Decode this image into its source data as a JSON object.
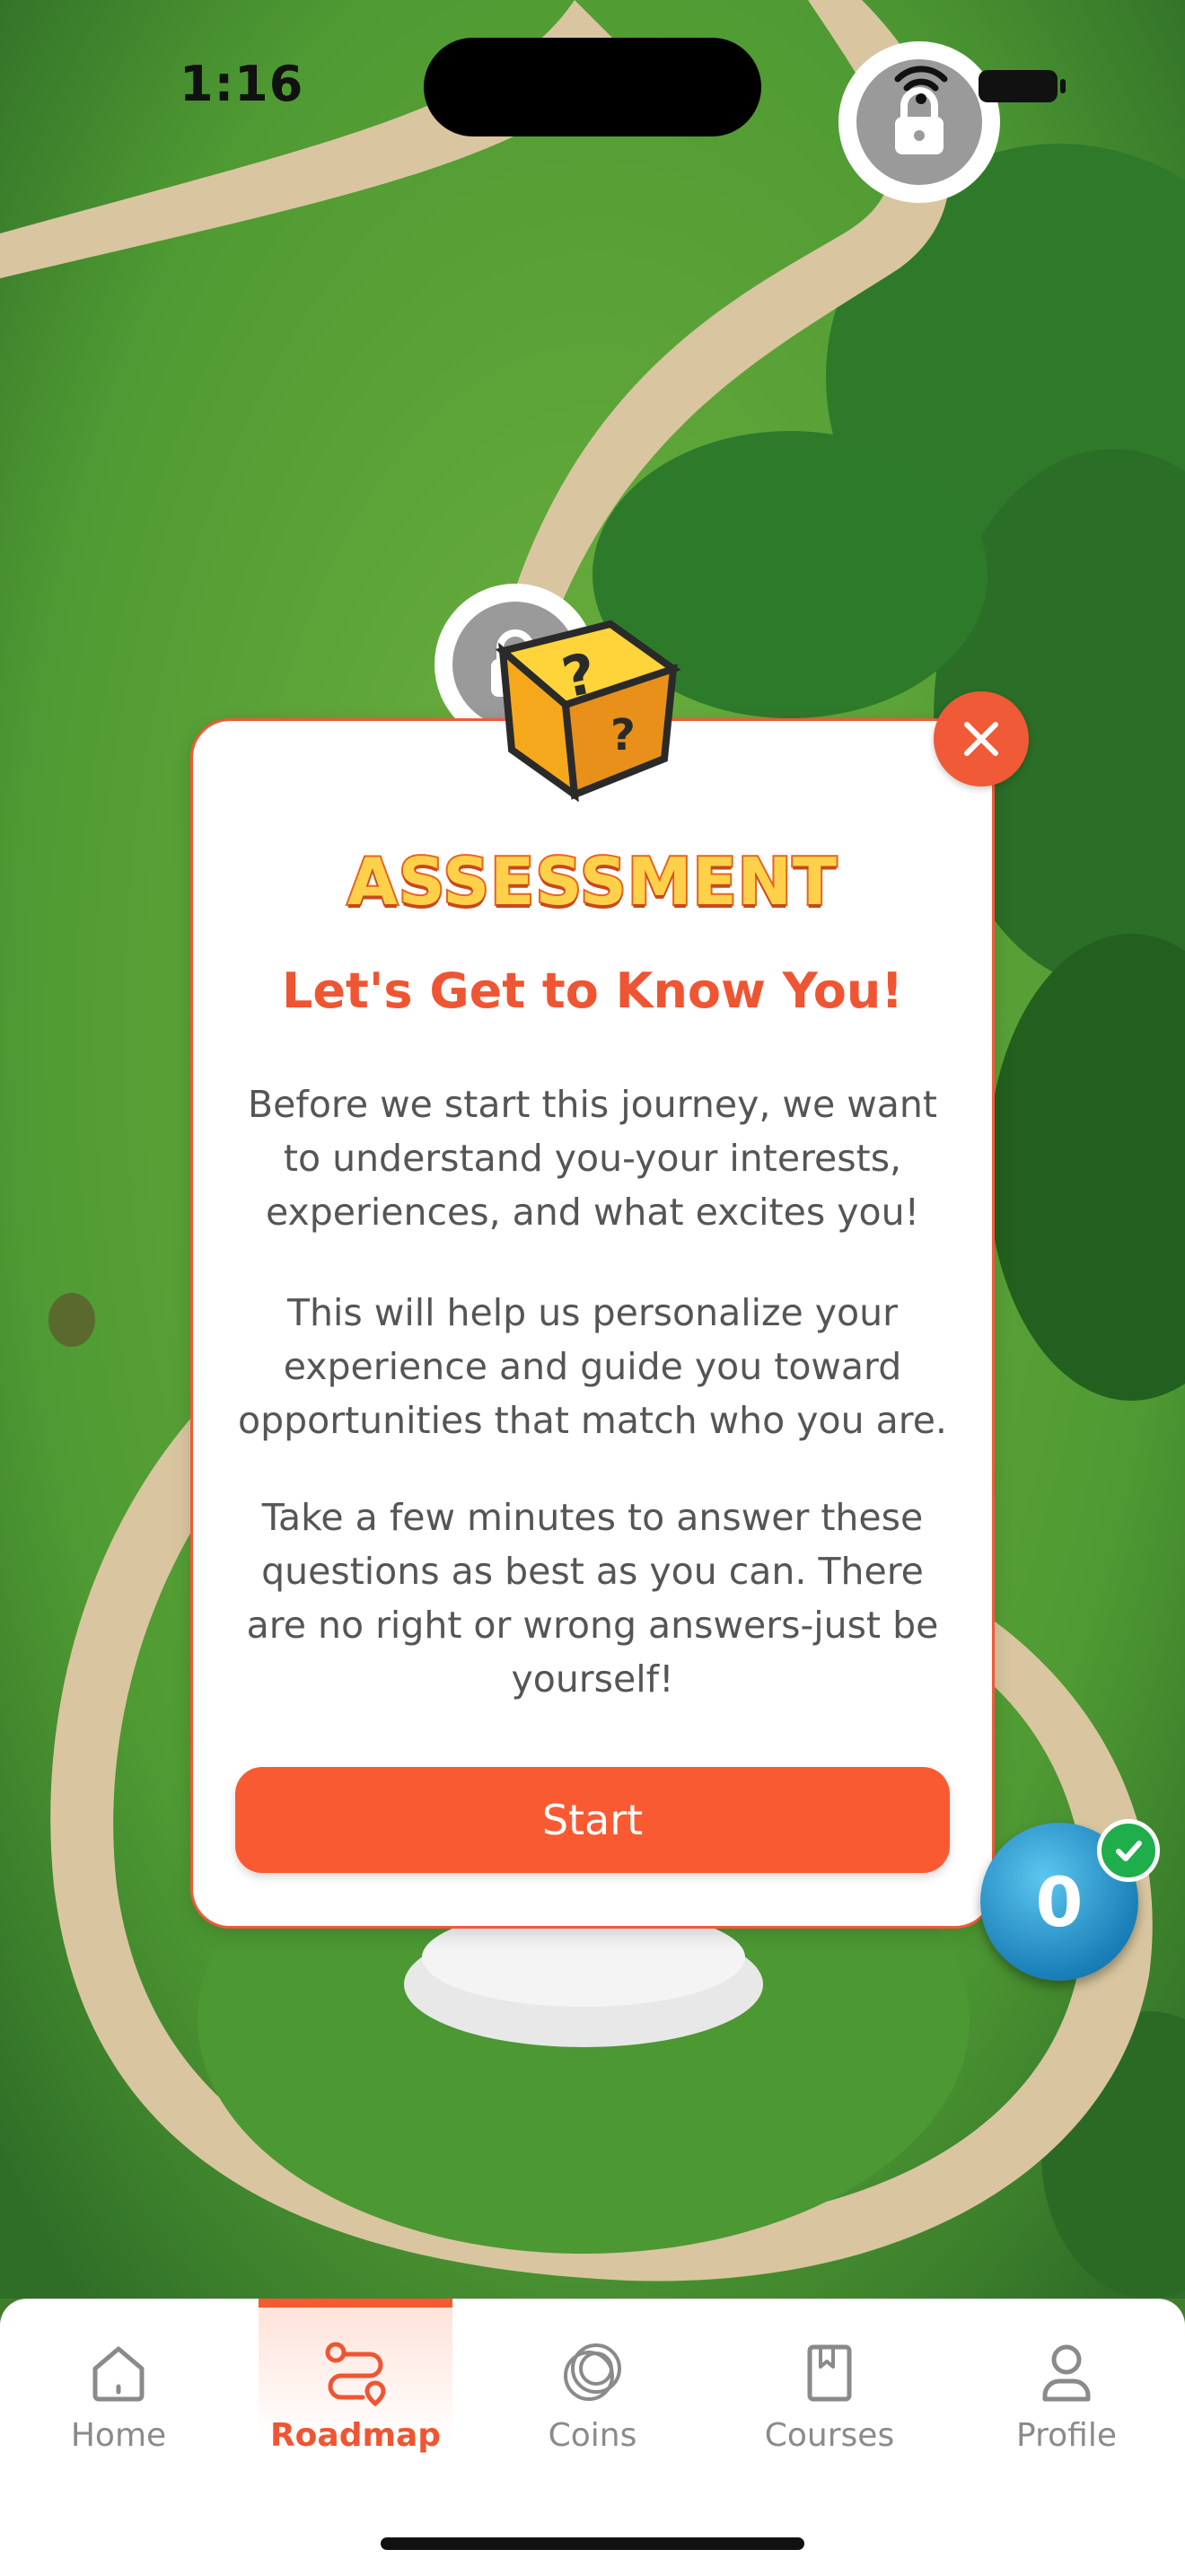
{
  "status_bar": {
    "time": "1:16"
  },
  "modal": {
    "badge_title": "ASSESSMENT",
    "headline": "Let's Get to Know You!",
    "paragraphs": [
      "Before we start this journey, we want to understand you-your interests, experiences, and what excites you!",
      "This will help us personalize your experience and guide you toward opportunities that match who you are.",
      "Take a few minutes to answer these questions as best as you can. There are no right or wrong answers-just be yourself!"
    ],
    "start_label": "Start",
    "colors": {
      "accent": "#f95a32",
      "title_gold": "#ffd14a"
    }
  },
  "coin_badge": {
    "count": "0",
    "completed": true
  },
  "tabbar": {
    "active": "Roadmap",
    "tabs": [
      {
        "label": "Home",
        "icon": "home-icon"
      },
      {
        "label": "Roadmap",
        "icon": "route-icon"
      },
      {
        "label": "Coins",
        "icon": "coins-icon"
      },
      {
        "label": "Courses",
        "icon": "book-icon"
      },
      {
        "label": "Profile",
        "icon": "profile-icon"
      }
    ]
  }
}
